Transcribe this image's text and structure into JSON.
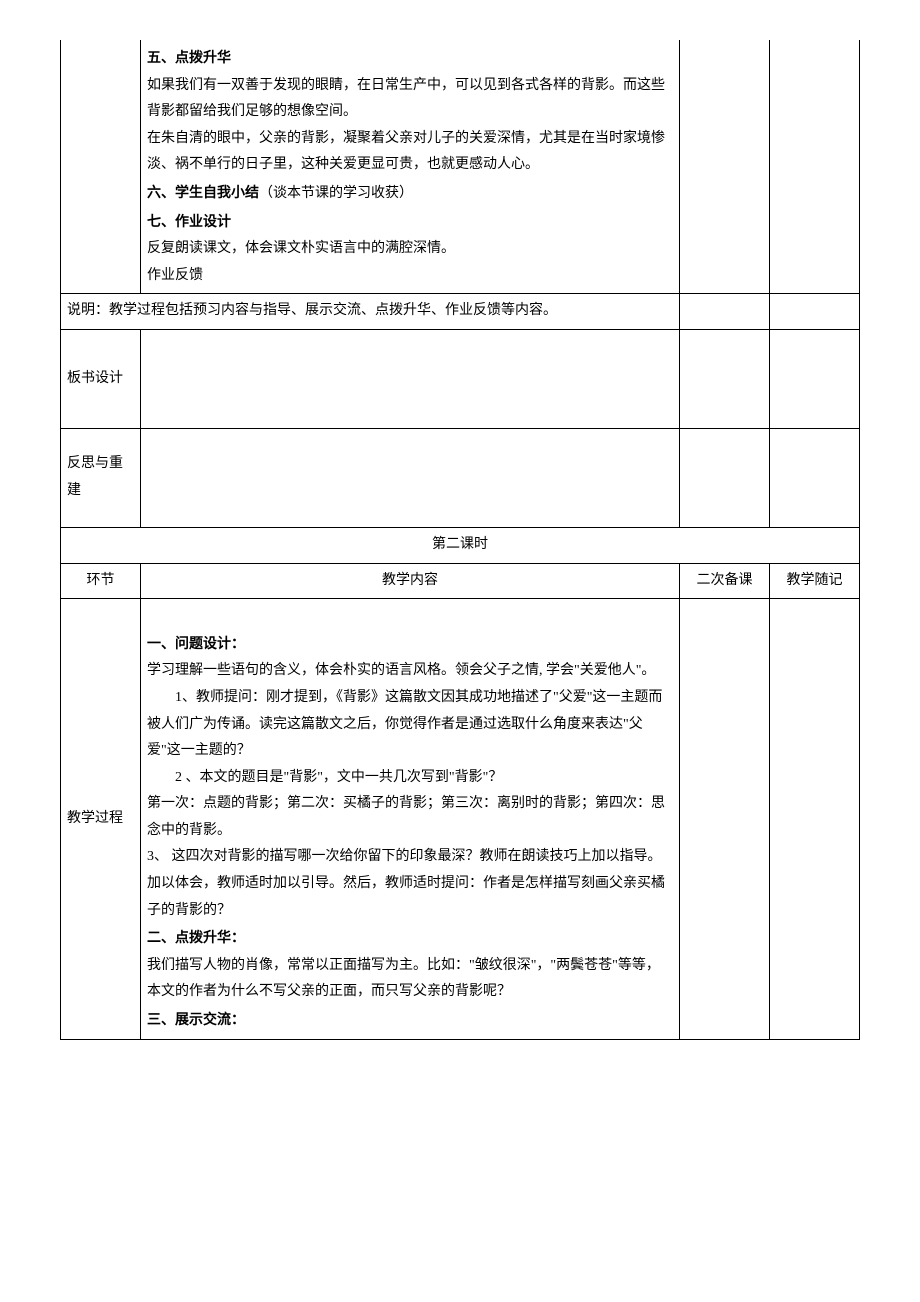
{
  "row1": {
    "h5": "五、点拨升华",
    "p1": "如果我们有一双善于发现的眼睛，在日常生产中，可以见到各式各样的背影。而这些背影都留给我们足够的想像空间。",
    "p2": "在朱自清的眼中，父亲的背影，凝聚着父亲对儿子的关爱深情，尤其是在当时家境惨淡、祸不单行的日子里，这种关爱更显可贵，也就更感动人心。",
    "h6": "六、学生自我小结",
    "h6_note": "（谈本节课的学习收获）",
    "h7": "七、作业设计",
    "p3": "反复朗读课文，体会课文朴实语言中的满腔深情。",
    "p4": "作业反馈"
  },
  "note_row": "说明：教学过程包括预习内容与指导、展示交流、点拨升华、作业反馈等内容。",
  "label_board": "板书设计",
  "label_reflect": "反思与重建",
  "lesson2_title": "第二课时",
  "header": {
    "c1": "环节",
    "c2": "教学内容",
    "c3": "二次备课",
    "c4": "教学随记"
  },
  "label_process": "教学过程",
  "row2": {
    "h1": "一、问题设计：",
    "p1": "学习理解一些语句的含义，体会朴实的语言风格。领会父子之情, 学会\"关爱他人\"。",
    "p2": "1、教师提问：刚才提到，《背影》这篇散文因其成功地描述了\"父爱\"这一主题而被人们广为传诵。读完这篇散文之后，你觉得作者是通过选取什么角度来表达\"父爱\"这一主题的？",
    "p3": "2 、本文的题目是\"背影\"，文中一共几次写到\"背影\"？",
    "p4": " 第一次：点题的背影；第二次：买橘子的背影；第三次：离别时的背影；第四次：思念中的背影。",
    "p5": "3、 这四次对背影的描写哪一次给你留下的印象最深？教师在朗读技巧上加以指导。加以体会，教师适时加以引导。然后，教师适时提问：作者是怎样描写刻画父亲买橘子的背影的？",
    "h2": "二、点拨升华：",
    "p6": "我们描写人物的肖像，常常以正面描写为主。比如：\"皱纹很深\"，\"两鬓苍苍\"等等，本文的作者为什么不写父亲的正面，而只写父亲的背影呢？",
    "h3": "三、展示交流："
  }
}
